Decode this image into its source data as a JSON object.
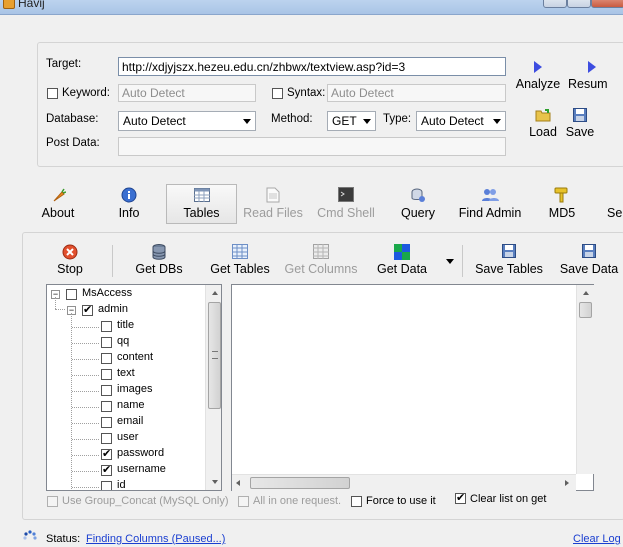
{
  "window": {
    "title": "Havij"
  },
  "target_panel": {
    "target_label": "Target:",
    "target_value": "http://xdjyjszx.hezeu.edu.cn/zhbwx/textview.asp?id=3",
    "keyword_label": "Keyword:",
    "keyword_placeholder": "Auto Detect",
    "syntax_label": "Syntax:",
    "syntax_placeholder": "Auto Detect",
    "database_label": "Database:",
    "database_value": "Auto Detect",
    "method_label": "Method:",
    "method_value": "GET",
    "type_label": "Type:",
    "type_value": "Auto Detect",
    "postdata_label": "Post Data:",
    "analyze_label": "Analyze",
    "resume_label": "Resum",
    "load_label": "Load",
    "save_label": "Save"
  },
  "main_tabs": [
    {
      "label": "About"
    },
    {
      "label": "Info"
    },
    {
      "label": "Tables"
    },
    {
      "label": "Read Files"
    },
    {
      "label": "Cmd Shell"
    },
    {
      "label": "Query"
    },
    {
      "label": "Find Admin"
    },
    {
      "label": "MD5"
    },
    {
      "label": "Se"
    }
  ],
  "tables_toolbar": {
    "stop": "Stop",
    "get_dbs": "Get DBs",
    "get_tables": "Get Tables",
    "get_columns": "Get Columns",
    "get_data": "Get Data",
    "save_tables": "Save Tables",
    "save_data": "Save Data"
  },
  "tree": {
    "root": "MsAccess",
    "table": "admin",
    "columns": [
      {
        "name": "title",
        "checked": false
      },
      {
        "name": "qq",
        "checked": false
      },
      {
        "name": "content",
        "checked": false
      },
      {
        "name": "text",
        "checked": false
      },
      {
        "name": "images",
        "checked": false
      },
      {
        "name": "name",
        "checked": false
      },
      {
        "name": "email",
        "checked": false
      },
      {
        "name": "user",
        "checked": false
      },
      {
        "name": "password",
        "checked": true
      },
      {
        "name": "username",
        "checked": true
      },
      {
        "name": "id",
        "checked": false
      }
    ]
  },
  "options": {
    "group_concat": "Use Group_Concat (MySQL Only)",
    "all_in_one": "All in one request.",
    "force": "Force to use it",
    "clear_list": "Clear list on get"
  },
  "status": {
    "label": "Status:",
    "value": "Finding Columns (Paused...)",
    "clear_log": "Clear Log"
  },
  "colors": {
    "accent_blue": "#3d4de0",
    "link": "#1a3ed0"
  }
}
